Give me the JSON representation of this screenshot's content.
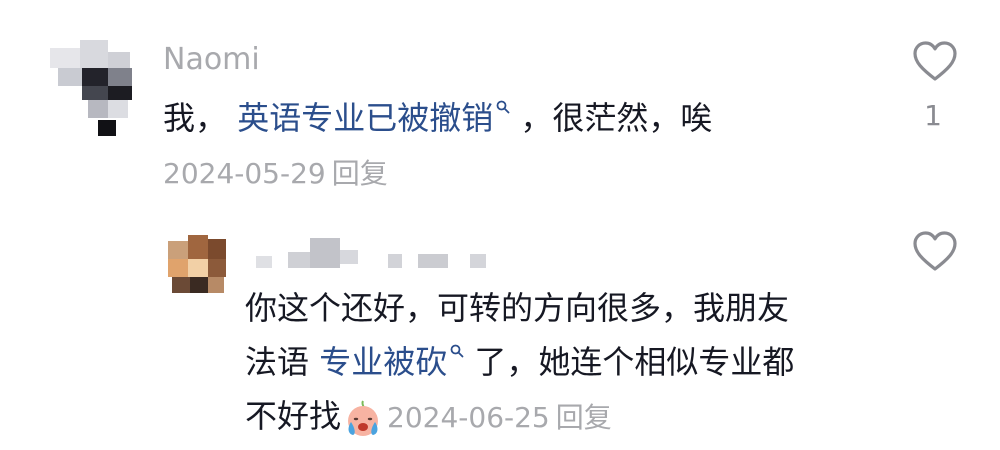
{
  "comments": [
    {
      "username": "Naomi",
      "text_prefix": "我，",
      "link_text": "英语专业已被撤销",
      "text_suffix": "，很茫然，唉",
      "date": "2024-05-29",
      "reply_label": "回复",
      "like_count": "1",
      "like_icon": "heart-outline-icon",
      "search_icon": "search-icon"
    },
    {
      "line1": "你这个还好，可转的方向很多，我朋友",
      "line2_prefix": "法语",
      "link_text": "专业被砍",
      "line2_suffix": "了，她连个相似专业都",
      "line3_text": "不好找",
      "emoji": "crying-face-emoji",
      "date": "2024-06-25",
      "reply_label": "回复",
      "like_icon": "heart-outline-icon"
    }
  ],
  "colors": {
    "text": "#161823",
    "muted": "#a8a9ad",
    "link": "#2b4e8c",
    "icon": "#8a8b91"
  }
}
